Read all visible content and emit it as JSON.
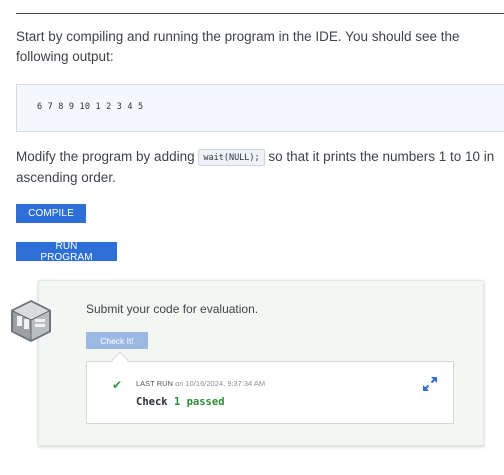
{
  "intro_text": "Start by compiling and running the program in the IDE. You should see the following output:",
  "output_sample": "6 7 8 9 10 1 2 3 4 5",
  "modify": {
    "before": "Modify the program by adding ",
    "code": "wait(NULL);",
    "after": " so that it prints the numbers 1 to 10 in ascending order."
  },
  "buttons": {
    "compile": "COMPILE",
    "run": "RUN PROGRAM"
  },
  "evaluation": {
    "prompt": "Submit your code for evaluation.",
    "check_button": "Check It!",
    "last_run_label": "LAST RUN",
    "last_run_on": "on",
    "last_run_timestamp": "10/16/2024, 9:37:34 AM",
    "result_prefix": "Check",
    "result_count": "1",
    "result_status": "passed"
  },
  "icons": {
    "status": "checkmark-icon",
    "expand": "expand-icon",
    "bot": "robot-avatar-icon"
  },
  "colors": {
    "accent": "#2d6fd6",
    "accent_disabled": "#9cb9e6",
    "success": "#2e9a3a"
  }
}
